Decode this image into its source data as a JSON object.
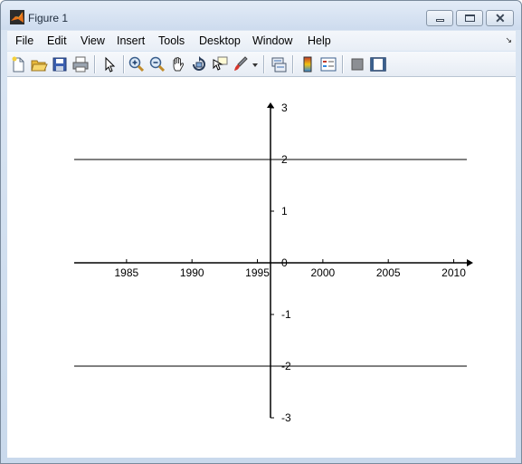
{
  "window": {
    "title": "Figure 1"
  },
  "menu": {
    "items": [
      "File",
      "Edit",
      "View",
      "Insert",
      "Tools",
      "Desktop",
      "Window",
      "Help"
    ],
    "dock_glyph": "↘"
  },
  "toolbar": {
    "buttons": [
      "new-figure-icon",
      "open-file-icon",
      "save-figure-icon",
      "print-figure-icon",
      "edit-plot-arrow-icon",
      "zoom-in-icon",
      "zoom-out-icon",
      "pan-hand-icon",
      "rotate-3d-icon",
      "data-cursor-icon",
      "brush-icon",
      "link-plot-icon",
      "colorbar-icon",
      "legend-icon",
      "hide-plot-tools-icon",
      "show-plot-tools-icon"
    ]
  },
  "chart_data": {
    "type": "line",
    "title": "",
    "xlabel": "",
    "ylabel": "",
    "xlim": [
      1981,
      2011
    ],
    "ylim": [
      -3,
      3
    ],
    "x_ticks": [
      1985,
      1990,
      1995,
      2000,
      2005,
      2010
    ],
    "y_ticks": [
      -3,
      -2,
      -1,
      0,
      1,
      2,
      3
    ],
    "x_axis_crosses_at_y": 0,
    "y_axis_crosses_at_x": 1996,
    "series": [
      {
        "x": [
          1981,
          2011
        ],
        "values": [
          2,
          2
        ]
      },
      {
        "x": [
          1981,
          2011
        ],
        "values": [
          -2,
          -2
        ]
      }
    ],
    "grid": false,
    "line_color": "#000000"
  }
}
